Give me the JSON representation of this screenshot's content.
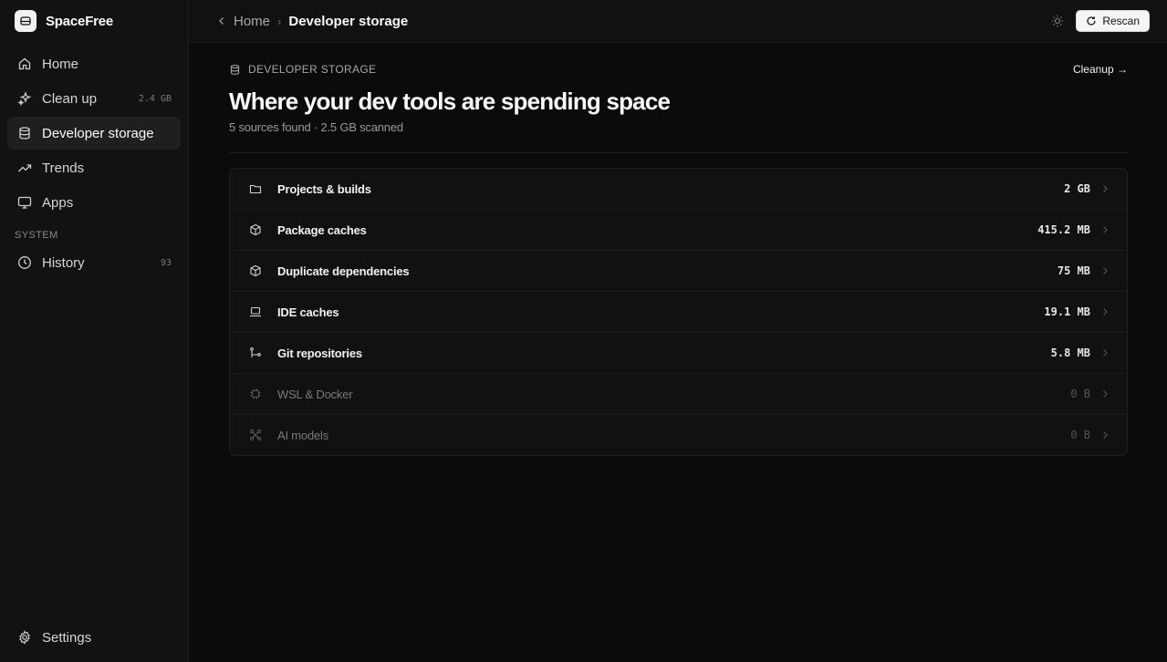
{
  "app": {
    "name": "SpaceFree"
  },
  "sidebar": {
    "items": [
      {
        "label": "Home",
        "meta": "",
        "icon": "home-icon"
      },
      {
        "label": "Clean up",
        "meta": "2.4 GB",
        "icon": "sparkle-icon"
      },
      {
        "label": "Developer storage",
        "meta": "",
        "icon": "database-icon",
        "active": true
      },
      {
        "label": "Trends",
        "meta": "",
        "icon": "trending-up-icon"
      },
      {
        "label": "Apps",
        "meta": "",
        "icon": "monitor-icon"
      }
    ],
    "system_label": "SYSTEM",
    "system_items": [
      {
        "label": "History",
        "meta": "93",
        "icon": "clock-icon"
      }
    ],
    "settings_label": "Settings"
  },
  "topbar": {
    "breadcrumb_home": "Home",
    "breadcrumb_current": "Developer storage",
    "rescan_label": "Rescan"
  },
  "page": {
    "eyebrow": "DEVELOPER STORAGE",
    "cleanup_link": "Cleanup →",
    "title": "Where your dev tools are spending space",
    "subtitle": "5 sources found · 2.5 GB scanned"
  },
  "sources": [
    {
      "name": "Projects & builds",
      "size": "2 GB",
      "icon": "folder-icon"
    },
    {
      "name": "Package caches",
      "size": "415.2 MB",
      "icon": "package-icon"
    },
    {
      "name": "Duplicate dependencies",
      "size": "75 MB",
      "icon": "package-icon"
    },
    {
      "name": "IDE caches",
      "size": "19.1 MB",
      "icon": "laptop-icon"
    },
    {
      "name": "Git repositories",
      "size": "5.8 MB",
      "icon": "git-branch-icon"
    },
    {
      "name": "WSL & Docker",
      "size": "0 B",
      "icon": "chip-icon",
      "dim": true
    },
    {
      "name": "AI models",
      "size": "0 B",
      "icon": "network-icon",
      "dim": true
    }
  ],
  "colors": {
    "background": "#0b0b0b",
    "sidebar": "#121212",
    "accent": "#f5f5f5"
  }
}
